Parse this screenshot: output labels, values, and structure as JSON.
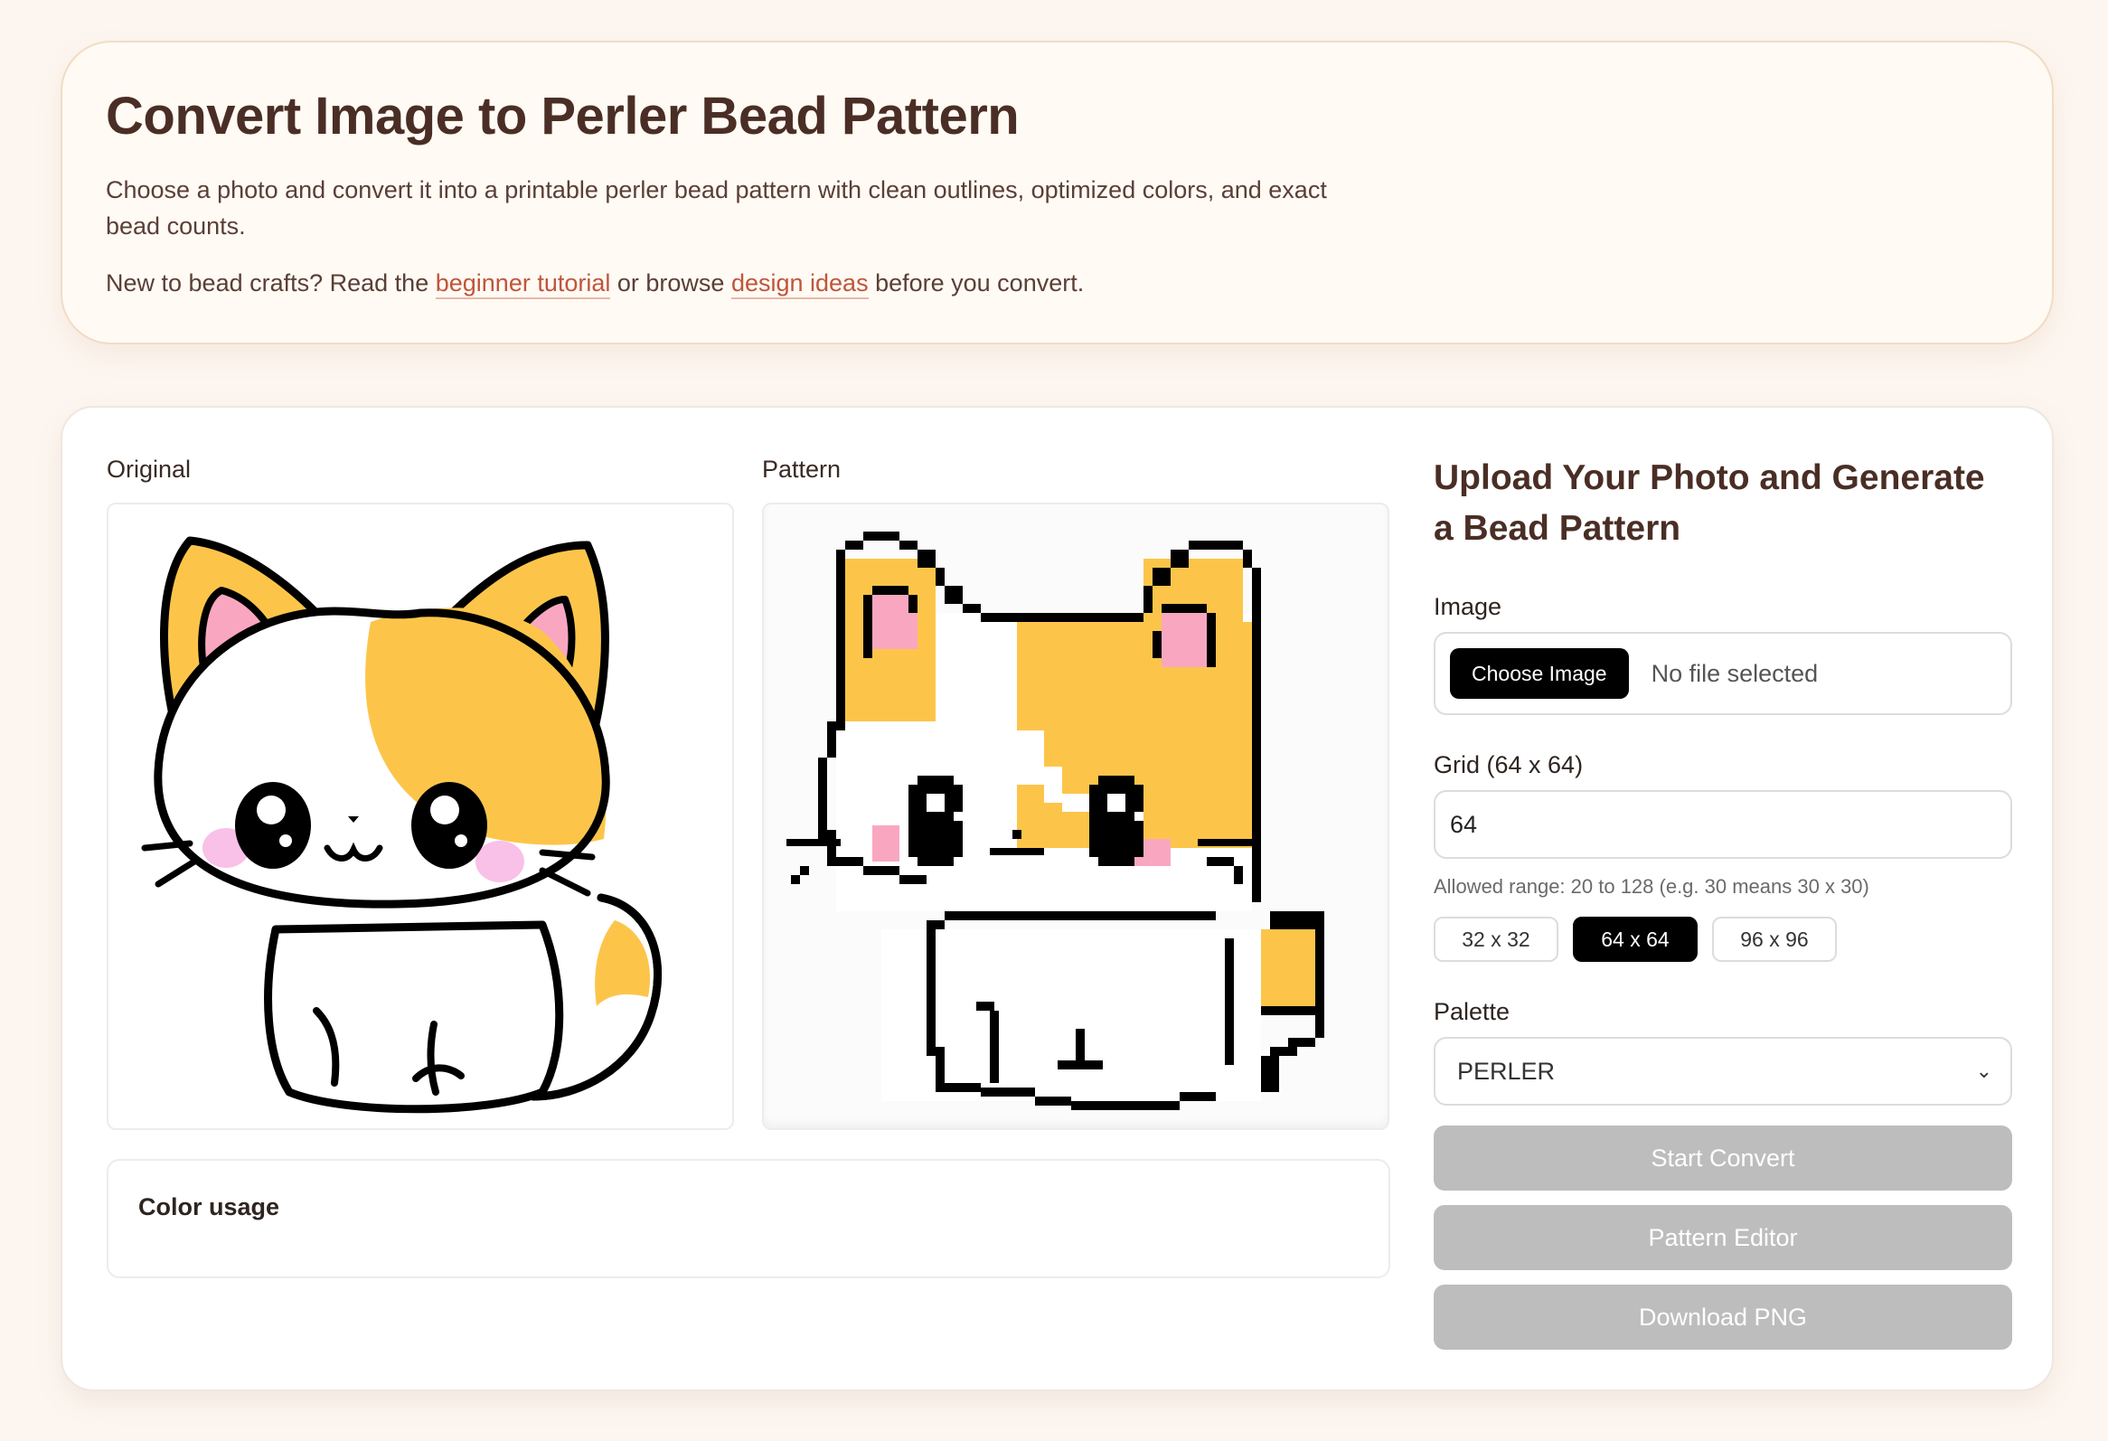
{
  "hero": {
    "title": "Convert Image to Perler Bead Pattern",
    "description": "Choose a photo and convert it into a printable perler bead pattern with clean outlines, optimized colors, and exact bead counts.",
    "intro_prefix": "New to bead crafts? Read the",
    "tutorial_link": "beginner tutorial",
    "intro_middle": "or browse",
    "ideas_link": "design ideas",
    "intro_suffix": "before you convert."
  },
  "preview": {
    "original_label": "Original",
    "pattern_label": "Pattern",
    "color_usage_label": "Color usage"
  },
  "sidebar": {
    "title": "Upload Your Photo and Generate a Bead Pattern",
    "image_label": "Image",
    "choose_button": "Choose Image",
    "file_status": "No file selected",
    "grid_label": "Grid (64 x 64)",
    "grid_value": "64",
    "grid_hint": "Allowed range: 20 to 128 (e.g. 30 means 30 x 30)",
    "presets": [
      "32 x 32",
      "64 x 64",
      "96 x 96"
    ],
    "active_preset": "64 x 64",
    "palette_label": "Palette",
    "palette_value": "PERLER",
    "start_convert": "Start Convert",
    "pattern_editor": "Pattern Editor",
    "download_png": "Download PNG"
  },
  "colors": {
    "background": "#fdf6f0",
    "heading": "#4a2e25",
    "link": "#c0553a",
    "cat_orange": "#fcc54a",
    "cat_pink": "#f9a7c0",
    "disabled_button": "#bdbdbd"
  }
}
